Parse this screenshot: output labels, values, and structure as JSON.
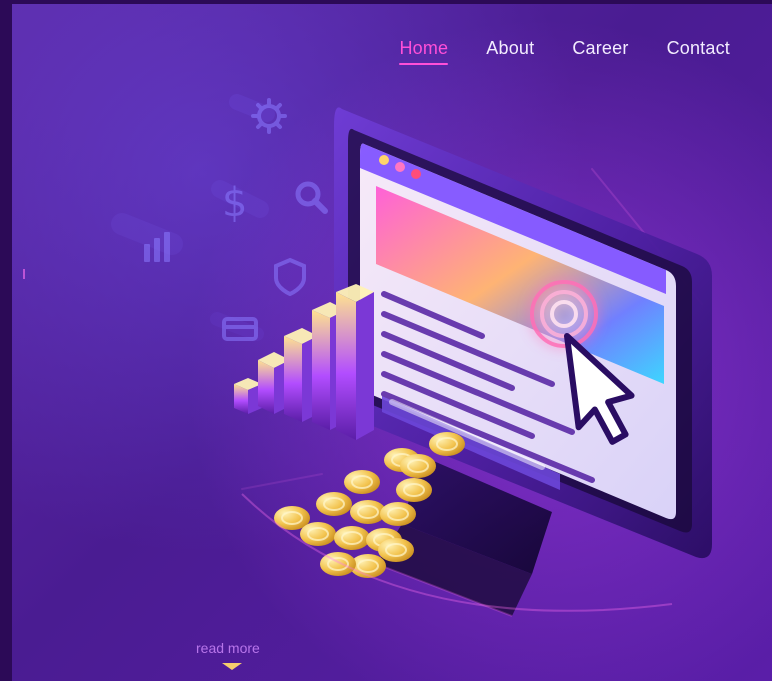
{
  "nav": {
    "items": [
      {
        "label": "Home",
        "active": true
      },
      {
        "label": "About",
        "active": false
      },
      {
        "label": "Career",
        "active": false
      },
      {
        "label": "Contact",
        "active": false
      }
    ]
  },
  "hero": {
    "read_more_label": "read more",
    "illustration_icons": [
      "gear-icon",
      "dollar-icon",
      "search-icon",
      "bar-chart-icon",
      "shield-icon",
      "card-icon",
      "browser-monitor-icon",
      "cursor-icon",
      "coin-stack-icon"
    ]
  },
  "colors": {
    "background": "#4a1c92",
    "accent": "#ff4fd8",
    "nav_text": "#f3ecff",
    "read_more": "#d28bff",
    "arrow": "#ffd76a"
  }
}
